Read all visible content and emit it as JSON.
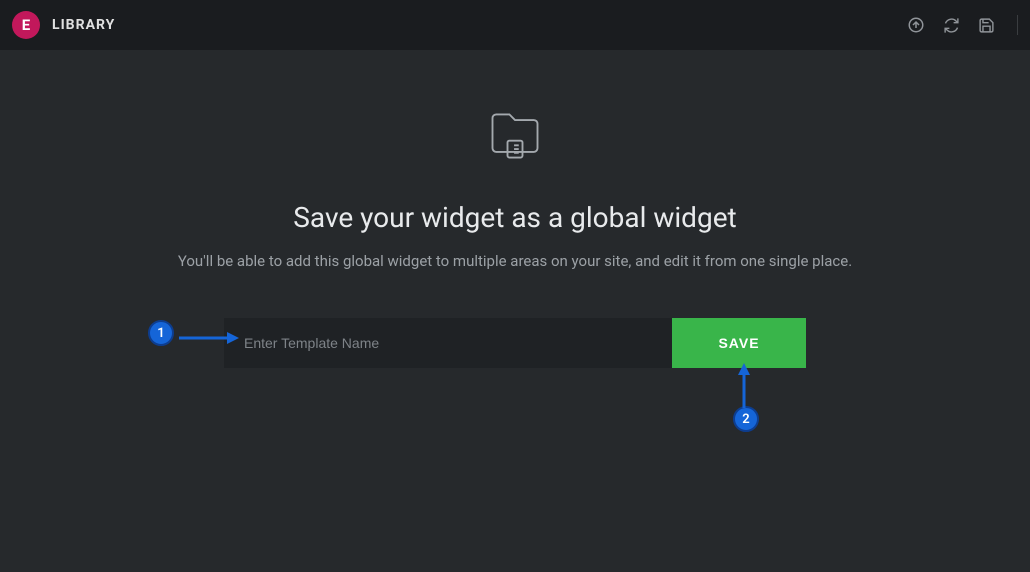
{
  "header": {
    "logo_letter": "E",
    "title": "LIBRARY"
  },
  "main": {
    "title": "Save your widget as a global widget",
    "subtitle": "You'll be able to add this global widget to multiple areas on your site, and edit it from one single place.",
    "input_placeholder": "Enter Template Name",
    "save_label": "SAVE"
  },
  "annotations": {
    "badge1": "1",
    "badge2": "2"
  }
}
